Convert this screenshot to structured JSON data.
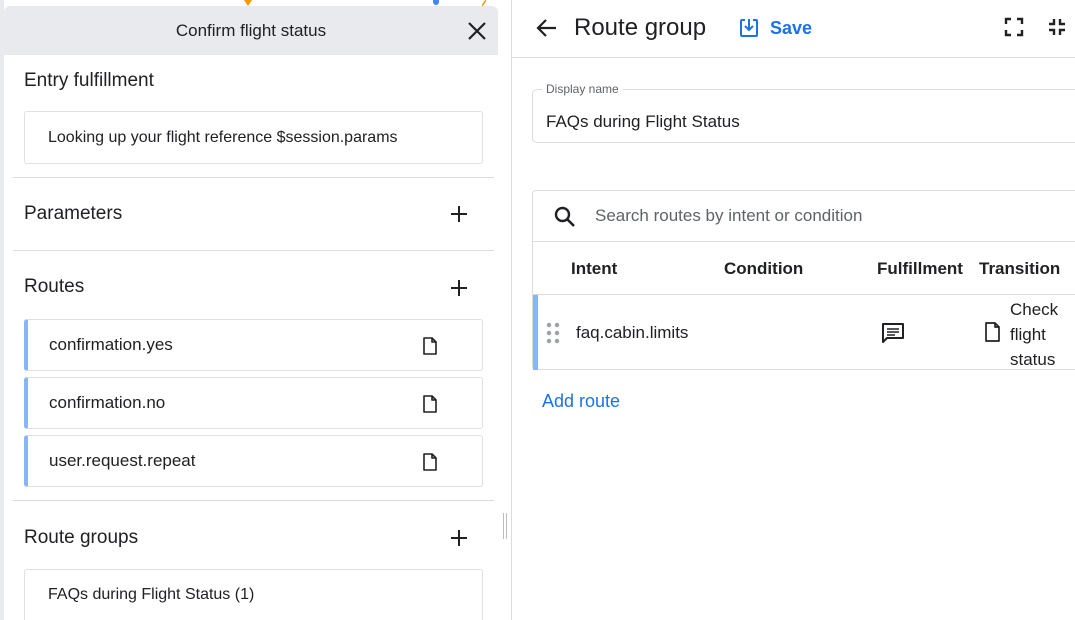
{
  "left_panel": {
    "title": "Confirm flight status",
    "entry_fulfillment": {
      "label": "Entry fulfillment",
      "text": "Looking up your flight reference $session.params"
    },
    "parameters": {
      "label": "Parameters"
    },
    "routes": {
      "label": "Routes",
      "items": [
        {
          "label": "confirmation.yes"
        },
        {
          "label": "confirmation.no"
        },
        {
          "label": "user.request.repeat"
        }
      ]
    },
    "route_groups": {
      "label": "Route groups",
      "items": [
        {
          "label": "FAQs during Flight Status (1)"
        }
      ]
    }
  },
  "right_panel": {
    "title": "Route group",
    "save_label": "Save",
    "display_name": {
      "label": "Display name",
      "value": "FAQs during Flight Status"
    },
    "search": {
      "placeholder": "Search routes by intent or condition"
    },
    "columns": {
      "intent": "Intent",
      "condition": "Condition",
      "fulfillment": "Fulfillment",
      "transition": "Transition"
    },
    "rows": [
      {
        "intent": "faq.cabin.limits",
        "condition": "",
        "transition": "Check flight status"
      }
    ],
    "add_route_label": "Add route"
  },
  "colors": {
    "accent": "#1a73e8",
    "route_indicator": "#8ab4f8",
    "header_bg": "#e8eaed",
    "border": "#dadce0"
  },
  "icons": {
    "close": "close-icon",
    "add": "plus-icon",
    "document": "document-icon",
    "back": "arrow-back-icon",
    "save": "save-download-icon",
    "fullscreen": "fullscreen-icon",
    "collapse": "fullscreen-exit-icon",
    "search": "search-icon",
    "drag": "drag-handle-icon",
    "fulfillment": "message-icon"
  }
}
